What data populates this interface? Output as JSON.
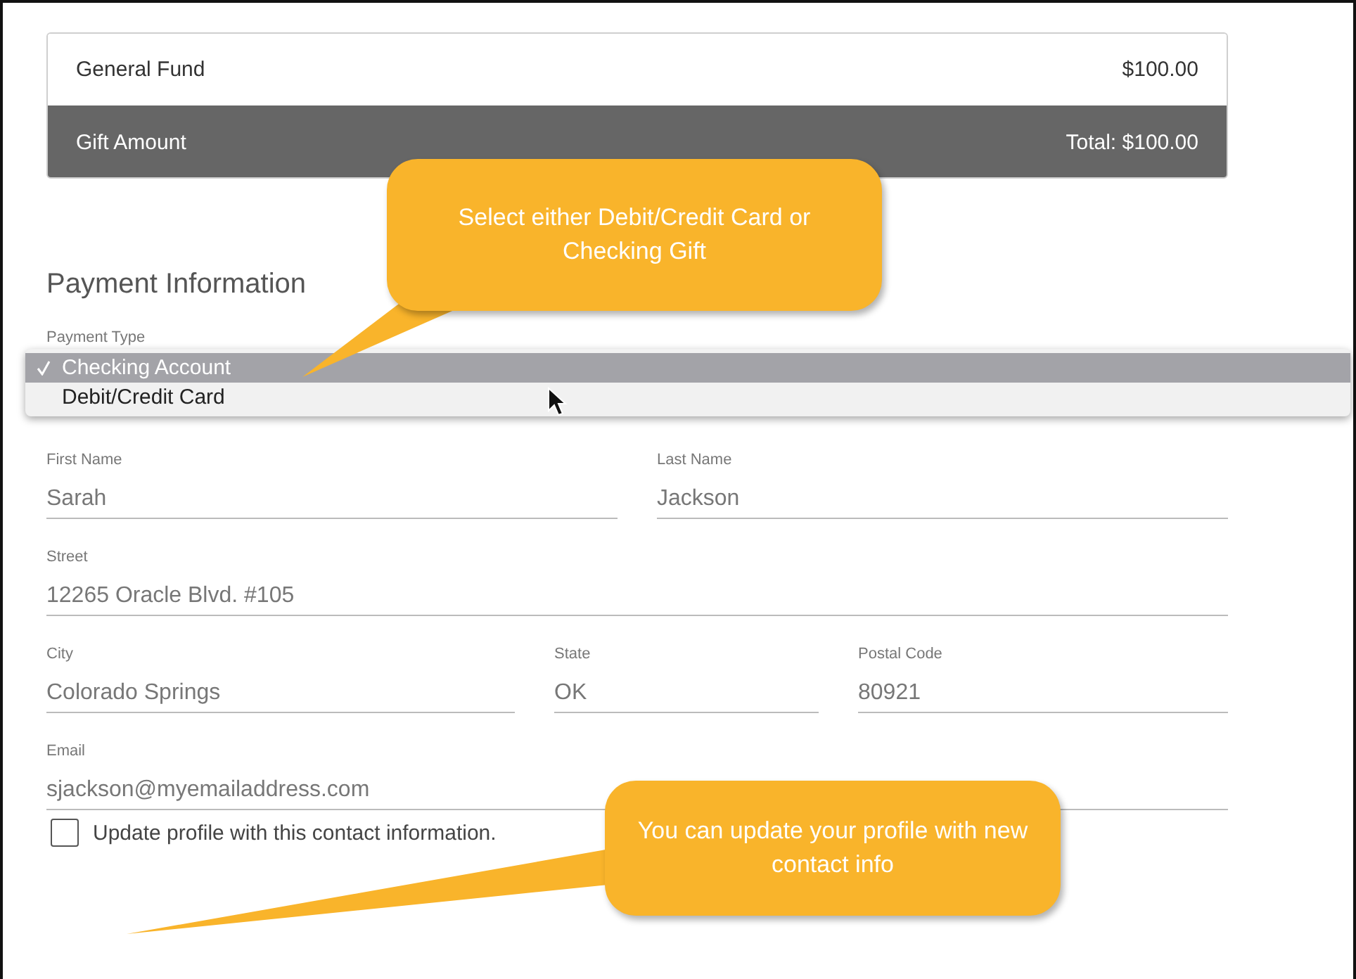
{
  "summary": {
    "fund": {
      "name": "General Fund",
      "amount": "$100.00"
    },
    "footer": {
      "label": "Gift Amount",
      "total": "Total: $100.00"
    }
  },
  "section_title": "Payment Information",
  "payment_type": {
    "label": "Payment Type",
    "options": [
      {
        "label": "Checking Account",
        "selected": true
      },
      {
        "label": "Debit/Credit Card",
        "selected": false
      }
    ]
  },
  "field_rows": [
    [
      {
        "label": "First Name",
        "value": "Sarah"
      },
      {
        "label": "Last Name",
        "value": "Jackson"
      }
    ],
    [
      {
        "label": "Street",
        "value": "12265 Oracle Blvd. #105"
      }
    ],
    [
      {
        "label": "City",
        "value": "Colorado Springs"
      },
      {
        "label": "State",
        "value": "OK"
      },
      {
        "label": "Postal Code",
        "value": "80921"
      }
    ],
    [
      {
        "label": "Email",
        "value": "sjackson@myemailaddress.com"
      }
    ]
  ],
  "update_profile": {
    "label": "Update profile with this contact information.",
    "checked": false
  },
  "callouts": [
    {
      "text": "Select either Debit/Credit Card or Checking Gift"
    },
    {
      "text": "You can update your profile with new contact info"
    }
  ]
}
